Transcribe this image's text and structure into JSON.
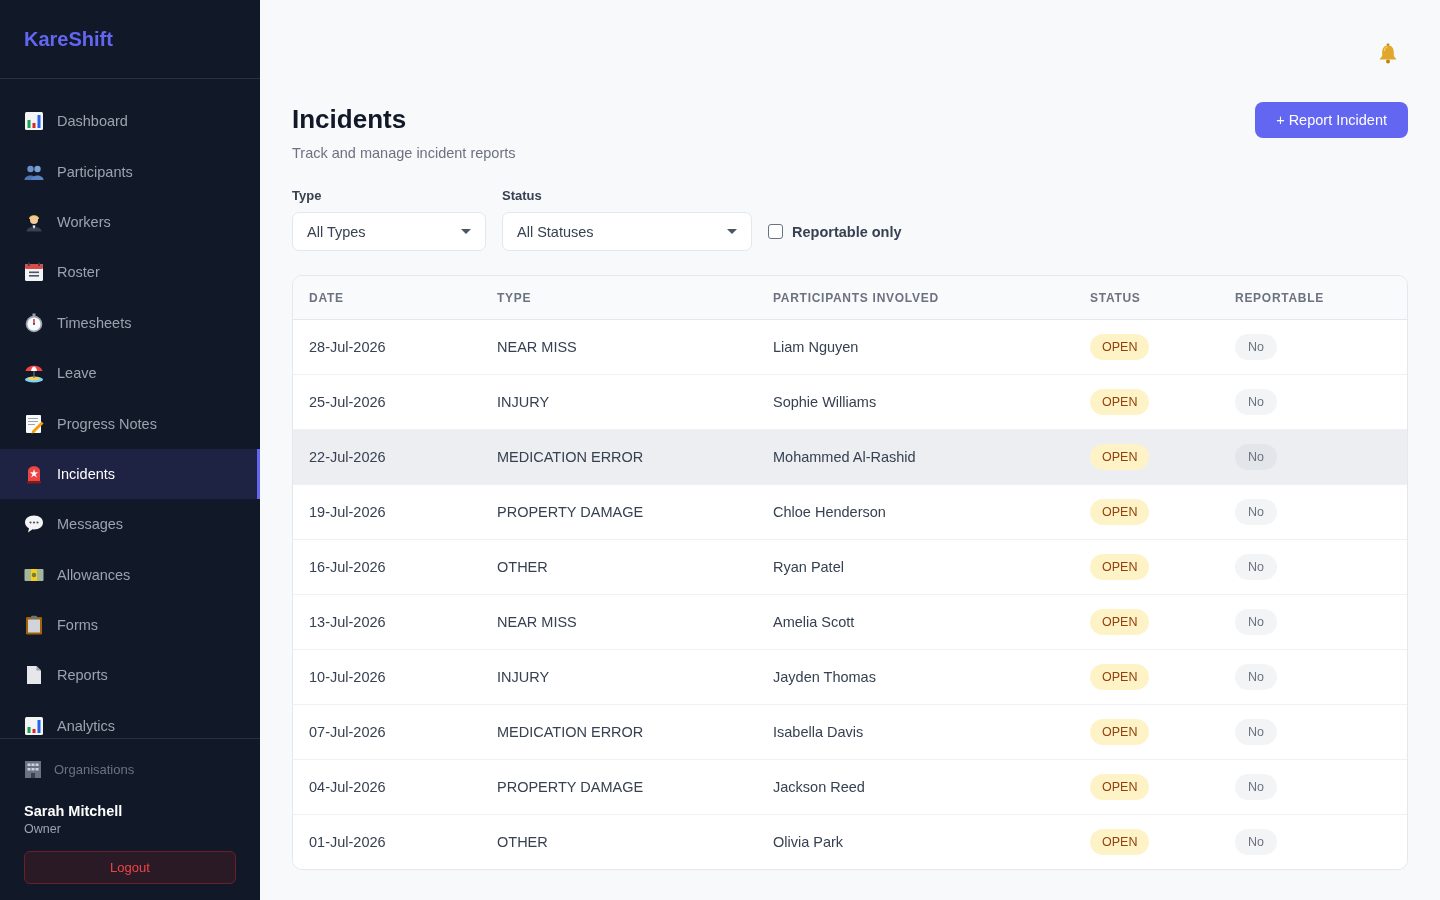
{
  "sidebar": {
    "logo": "KareShift",
    "nav_items": [
      {
        "label": "Dashboard",
        "selected": false
      },
      {
        "label": "Participants",
        "selected": false
      },
      {
        "label": "Workers",
        "selected": false
      },
      {
        "label": "Roster",
        "selected": false
      },
      {
        "label": "Timesheets",
        "selected": false
      },
      {
        "label": "Leave",
        "selected": false
      },
      {
        "label": "Progress Notes",
        "selected": false
      },
      {
        "label": "Incidents",
        "selected": true
      },
      {
        "label": "Messages",
        "selected": false
      },
      {
        "label": "Allowances",
        "selected": false
      },
      {
        "label": "Forms",
        "selected": false
      },
      {
        "label": "Reports",
        "selected": false
      },
      {
        "label": "Analytics",
        "selected": false
      }
    ],
    "organisations_link": "Organisations",
    "user": {
      "name": "Sarah Mitchell",
      "role": "Owner"
    },
    "logout_button": "Logout"
  },
  "page": {
    "title": "Incidents",
    "subtitle": "Track and manage incident reports",
    "primary_button": "+ Report Incident"
  },
  "filters": {
    "type": {
      "label": "Type",
      "value": "All Types"
    },
    "status": {
      "label": "Status",
      "value": "All Statuses"
    },
    "reportable_only": {
      "label": "Reportable only",
      "checked": false
    }
  },
  "table": {
    "columns": [
      "DATE",
      "TYPE",
      "PARTICIPANTS INVOLVED",
      "STATUS",
      "REPORTABLE"
    ],
    "rows": [
      {
        "date": "28-Jul-2026",
        "type": "NEAR MISS",
        "participants": "Liam Nguyen",
        "status": "OPEN",
        "reportable": "No",
        "highlighted": false
      },
      {
        "date": "25-Jul-2026",
        "type": "INJURY",
        "participants": "Sophie Williams",
        "status": "OPEN",
        "reportable": "No",
        "highlighted": false
      },
      {
        "date": "22-Jul-2026",
        "type": "MEDICATION ERROR",
        "participants": "Mohammed Al-Rashid",
        "status": "OPEN",
        "reportable": "No",
        "highlighted": true
      },
      {
        "date": "19-Jul-2026",
        "type": "PROPERTY DAMAGE",
        "participants": "Chloe Henderson",
        "status": "OPEN",
        "reportable": "No",
        "highlighted": false
      },
      {
        "date": "16-Jul-2026",
        "type": "OTHER",
        "participants": "Ryan Patel",
        "status": "OPEN",
        "reportable": "No",
        "highlighted": false
      },
      {
        "date": "13-Jul-2026",
        "type": "NEAR MISS",
        "participants": "Amelia Scott",
        "status": "OPEN",
        "reportable": "No",
        "highlighted": false
      },
      {
        "date": "10-Jul-2026",
        "type": "INJURY",
        "participants": "Jayden Thomas",
        "status": "OPEN",
        "reportable": "No",
        "highlighted": false
      },
      {
        "date": "07-Jul-2026",
        "type": "MEDICATION ERROR",
        "participants": "Isabella Davis",
        "status": "OPEN",
        "reportable": "No",
        "highlighted": false
      },
      {
        "date": "04-Jul-2026",
        "type": "PROPERTY DAMAGE",
        "participants": "Jackson Reed",
        "status": "OPEN",
        "reportable": "No",
        "highlighted": false
      },
      {
        "date": "01-Jul-2026",
        "type": "OTHER",
        "participants": "Olivia Park",
        "status": "OPEN",
        "reportable": "No",
        "highlighted": false
      }
    ]
  }
}
